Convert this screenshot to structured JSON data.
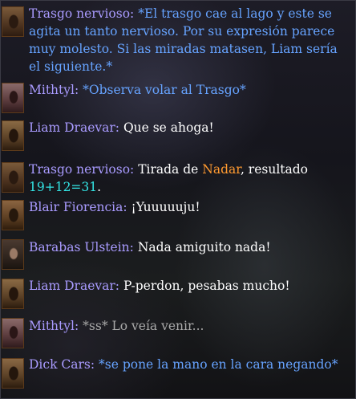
{
  "chat": {
    "messages": [
      {
        "avatar": "trasgo-portrait",
        "speaker": "Trasgo nervioso:",
        "text": "*El trasgo cae al lago y este se agita un tanto nervioso. Por su expresión parece muy molesto. Si las miradas matasen, Liam sería el siguiente.*"
      },
      {
        "avatar": "mithtyl-portrait",
        "speaker": "Mithtyl:",
        "text": "*Observa volar al Trasgo*"
      },
      {
        "avatar": "liam-portrait",
        "speaker": "Liam Draevar:",
        "text": "Que se ahoga!"
      },
      {
        "avatar": "trasgo-portrait",
        "speaker": "Trasgo nervioso:",
        "text_pre": "Tirada de",
        "skill": "Nadar",
        "text_mid": ", resultado",
        "roll": "19+12=31",
        "text_post": "."
      },
      {
        "avatar": "blair-portrait",
        "speaker": "Blair Fiorencia:",
        "text": "¡Yuuuuuju!"
      },
      {
        "avatar": "barabas-portrait",
        "speaker": "Barabas Ulstein:",
        "text": "Nada amiguito nada!"
      },
      {
        "avatar": "liam-portrait",
        "speaker": "Liam Draevar:",
        "text": "P-perdon, pesabas mucho!"
      },
      {
        "avatar": "mithtyl-portrait",
        "speaker": "Mithtyl:",
        "text": "*ss* Lo veía venir..."
      },
      {
        "avatar": "dick-portrait",
        "speaker": "Dick Cars:",
        "text": "*se pone la mano en la cara negando*"
      }
    ]
  },
  "colors": {
    "speaker": "#a99bff",
    "action_text": "#66a3ff",
    "speech_text": "#ffffff",
    "whisper_text": "#a9a9a9",
    "skill_name": "#ff9a30",
    "roll_result": "#33e6e6"
  }
}
